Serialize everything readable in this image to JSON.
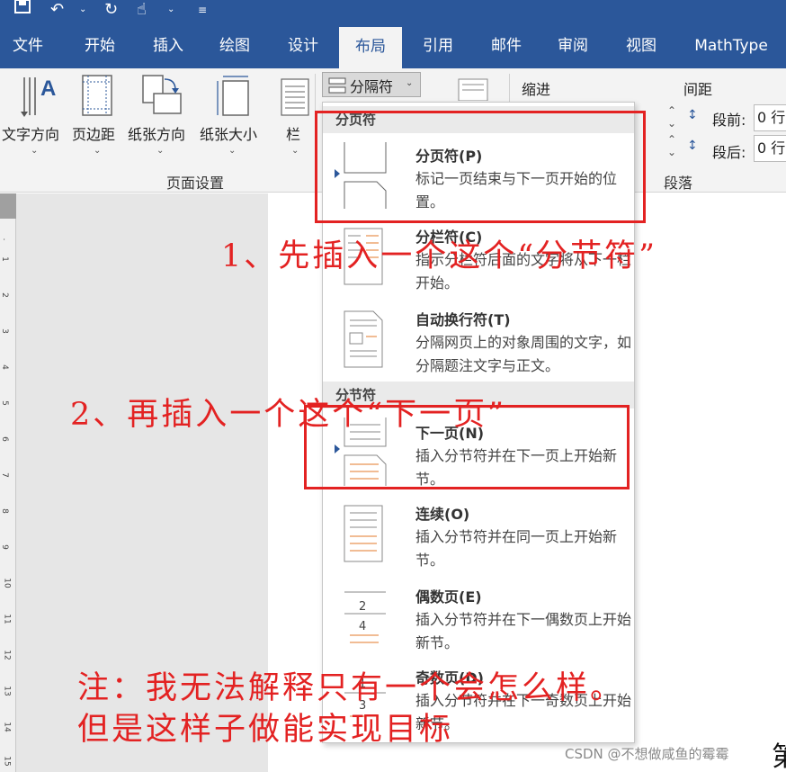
{
  "tabs": [
    "文件",
    "开始",
    "插入",
    "绘图",
    "设计",
    "布局",
    "引用",
    "邮件",
    "审阅",
    "视图",
    "MathType"
  ],
  "active_tab": "布局",
  "ribbon": {
    "text_direction": "文字方向",
    "margins": "页边距",
    "orientation": "纸张方向",
    "size": "纸张大小",
    "columns": "栏",
    "breaks_button": "分隔符",
    "page_setup_group": "页面设置",
    "indent_label": "缩进",
    "spacing_label": "间距",
    "before_label": "段前:",
    "after_label": "段后:",
    "before_value": "0 行",
    "after_value": "0 行",
    "paragraph_group": "段落"
  },
  "menu": {
    "page_breaks_header": "分页符",
    "section_breaks_header": "分节符",
    "items": [
      {
        "title": "分页符(P)",
        "desc": "标记一页结束与下一页开始的位置。"
      },
      {
        "title": "分栏符(C)",
        "desc": "指示分栏符后面的文字将从下一栏开始。"
      },
      {
        "title": "自动换行符(T)",
        "desc": "分隔网页上的对象周围的文字，如分隔题注文字与正文。"
      },
      {
        "title": "下一页(N)",
        "desc": "插入分节符并在下一页上开始新节。"
      },
      {
        "title": "连续(O)",
        "desc": "插入分节符并在同一页上开始新节。"
      },
      {
        "title": "偶数页(E)",
        "desc": "插入分节符并在下一偶数页上开始新节。"
      },
      {
        "title": "奇数页(D)",
        "desc": "插入分节符并在下一奇数页上开始新节。"
      }
    ]
  },
  "annotations": {
    "step1": "1、先插入一个这个“分节符”",
    "step2": "2、再插入一个这个“下一页”",
    "note_line1": "注：我无法解释只有一个会怎么样。",
    "note_line2": "但是这样子做能实现目标"
  },
  "watermark": "CSDN @不想做咸鱼的霉霉",
  "doc_edge_char": "第",
  "colors": {
    "ribbon_blue": "#2b579a",
    "annotation_red": "#e32222"
  }
}
